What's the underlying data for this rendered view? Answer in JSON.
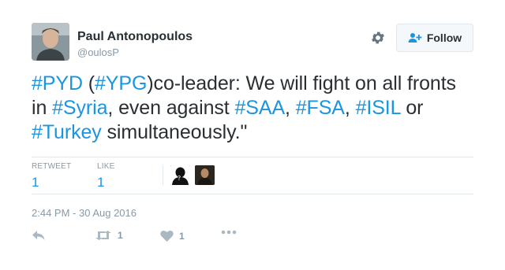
{
  "author": {
    "name": "Paul Antonopoulos",
    "handle": "@oulosP"
  },
  "follow_button": {
    "label": "Follow"
  },
  "tweet": {
    "segments": [
      {
        "text": "#PYD",
        "tag": true
      },
      {
        "text": " (",
        "tag": false
      },
      {
        "text": "#YPG",
        "tag": true
      },
      {
        "text": ")co-leader: We will fight on all fronts in ",
        "tag": false
      },
      {
        "text": "#Syria",
        "tag": true
      },
      {
        "text": ", even against ",
        "tag": false
      },
      {
        "text": "#SAA",
        "tag": true
      },
      {
        "text": ", ",
        "tag": false
      },
      {
        "text": "#FSA",
        "tag": true
      },
      {
        "text": ", ",
        "tag": false
      },
      {
        "text": "#ISIL",
        "tag": true
      },
      {
        "text": " or ",
        "tag": false
      },
      {
        "text": "#Turkey",
        "tag": true
      },
      {
        "text": " simultaneously.\"",
        "tag": false
      }
    ]
  },
  "stats": {
    "retweet_label": "RETWEET",
    "retweet_count": "1",
    "like_label": "LIKE",
    "like_count": "1"
  },
  "timestamp": "2:44 PM - 30 Aug 2016",
  "actions": {
    "retweet_count": "1",
    "like_count": "1"
  },
  "colors": {
    "link": "#1b95e0",
    "muted": "#8899a6",
    "text": "#292f33",
    "border": "#e1e8ed"
  },
  "icons": [
    "gear-icon",
    "follow-person-icon",
    "reply-icon",
    "retweet-icon",
    "heart-icon",
    "more-icon"
  ]
}
